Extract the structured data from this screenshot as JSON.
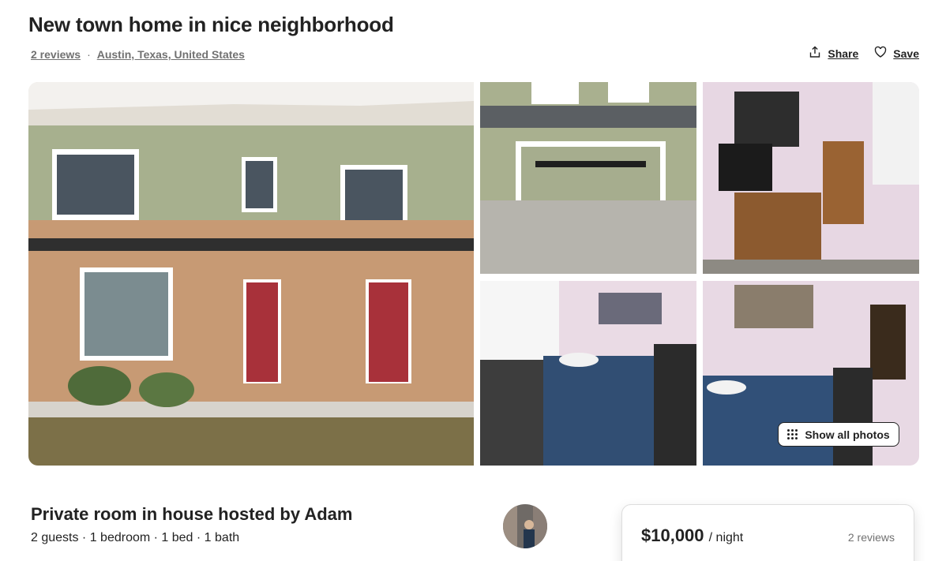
{
  "listing": {
    "title": "New town home in nice neighborhood",
    "reviews_link": "2 reviews",
    "separator": "·",
    "location": "Austin, Texas, United States"
  },
  "actions": {
    "share_label": "Share",
    "save_label": "Save",
    "share_icon": "share-icon",
    "save_icon": "heart-icon"
  },
  "gallery": {
    "show_all_label": "Show all photos"
  },
  "host": {
    "subtitle": "Private room in house hosted by Adam",
    "details": "2 guests · 1 bedroom · 1 bed · 1 bath"
  },
  "booking": {
    "price": "$10,000",
    "per_night": "/ night",
    "reviews": "2 reviews"
  },
  "colors": {
    "text": "#222222",
    "muted": "#717171",
    "border": "#dddddd"
  }
}
